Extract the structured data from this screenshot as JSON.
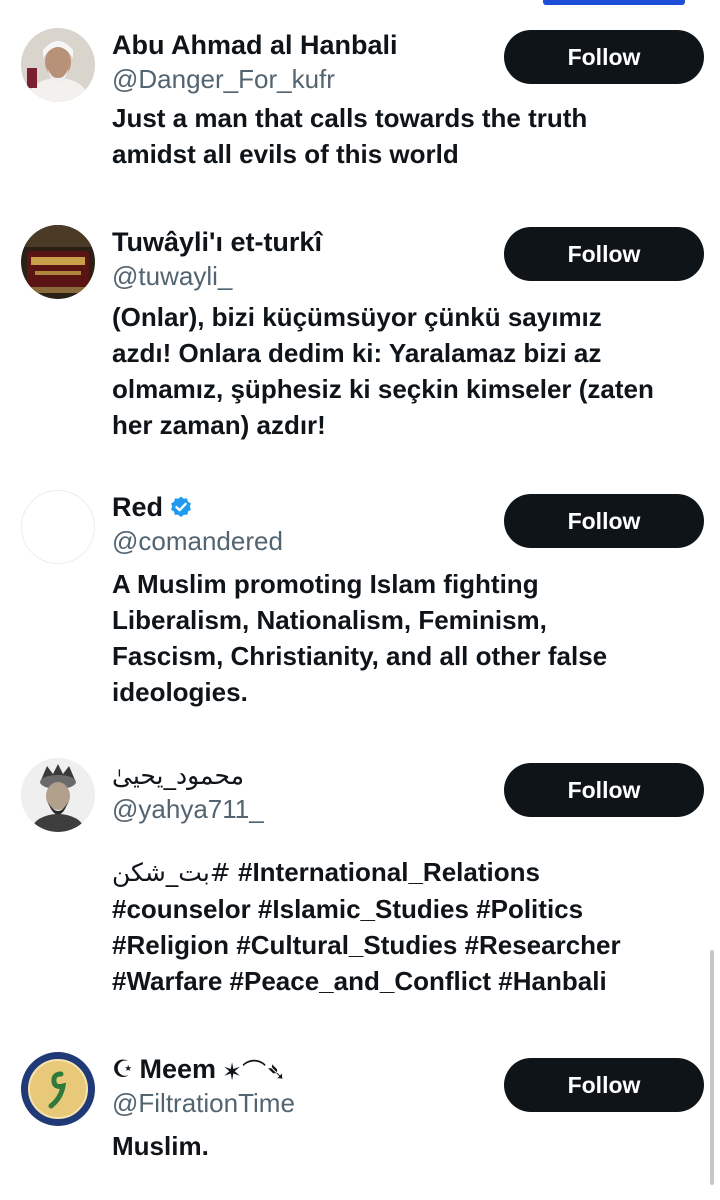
{
  "follow_label": "Follow",
  "accent": {
    "tab_indicator": "#1d4ed8",
    "button_bg": "#0f1419",
    "verified_badge": "#1d9bf0"
  },
  "accounts": [
    {
      "name": "Abu Ahmad al Hanbali",
      "handle": "@Danger_For_kufr",
      "avatar": "elderly-man-avatar",
      "bio_lines": [
        "Just a man that calls towards the truth",
        "amidst all evils of this world"
      ]
    },
    {
      "name": "Tuwâyli'ı et-turkî",
      "handle": "@tuwayli_",
      "avatar": "book-avatar",
      "bio_lines": [
        "(Onlar), bizi küçümsüyor çünkü sayımız",
        "azdı! Onlara dedim ki: Yaralamaz bizi az",
        "olmamız, şüphesiz ki seçkin kimseler (zaten",
        "her zaman) azdır!"
      ]
    },
    {
      "name": "Red",
      "handle": "@comandered",
      "avatar": "blank-avatar",
      "verified": true,
      "badge_icon": "verified-badge-icon",
      "bio_lines": [
        "A Muslim promoting Islam fighting",
        "Liberalism, Nationalism, Feminism,",
        "Fascism, Christianity, and all other false",
        "ideologies."
      ]
    },
    {
      "name": "محمود_يحيیٰ",
      "handle": "@yahya711_",
      "avatar": "turbaned-portrait-avatar",
      "bio_arabic": "#بت_شکن",
      "bio_lines": [
        "#International_Relations",
        "#counselor #Islamic_Studies #Politics",
        "#Religion #Cultural_Studies #Researcher",
        "#Warfare #Peace_and_Conflict #Hanbali"
      ]
    },
    {
      "name_prefix": "☪",
      "name": "Meem",
      "name_suffix": "✶⌒➴",
      "handle": "@FiltrationTime",
      "avatar": "calligraphy-emblem-avatar",
      "bio_lines": [
        "Muslim."
      ]
    }
  ]
}
